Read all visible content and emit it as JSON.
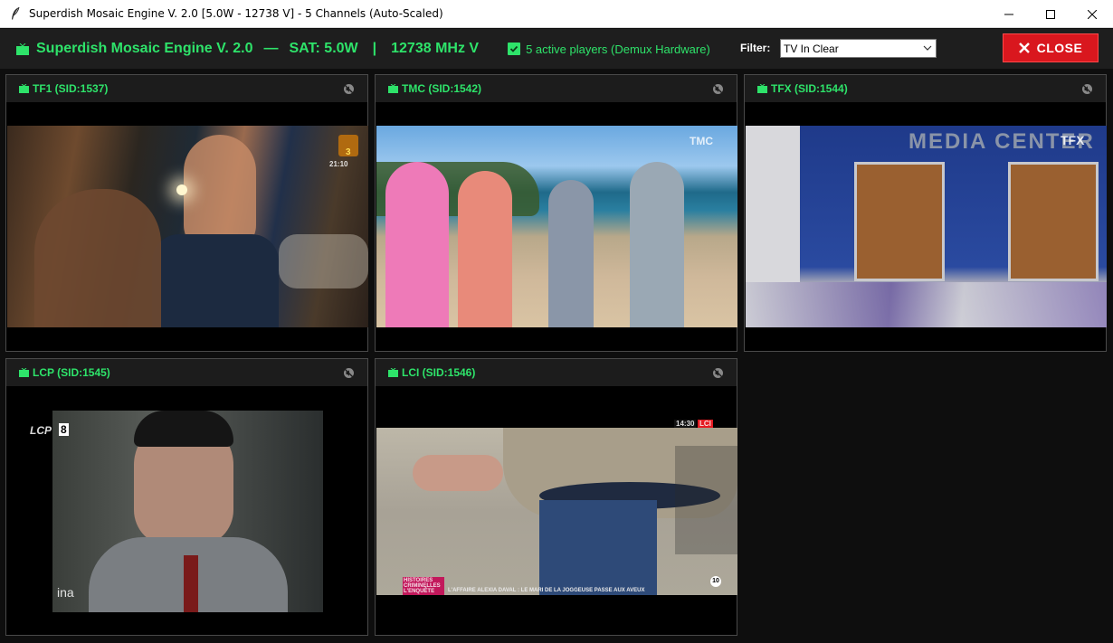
{
  "window": {
    "title": "Superdish Mosaic Engine V. 2.0 [5.0W - 12738 V] - 5 Channels (Auto-Scaled)"
  },
  "toolbar": {
    "app_name": "Superdish Mosaic Engine V. 2.0",
    "separator1": "—",
    "sat": "SAT: 5.0W",
    "separator2": "|",
    "freq": "12738 MHz V",
    "status": "5 active players (Demux Hardware)",
    "filter_label": "Filter:",
    "filter_value": "TV In Clear",
    "close_label": "CLOSE"
  },
  "colors": {
    "accent": "#2ee36a",
    "close": "#d9171e",
    "background": "#0e0e0e",
    "panel_header": "#1c1c1c"
  },
  "channels": [
    {
      "name": "TF1 (SID:1537)",
      "icon": "tv-icon",
      "audio": "muted-speaker-icon",
      "overlay": {
        "badge": "3",
        "time": "21:10"
      }
    },
    {
      "name": "TMC (SID:1542)",
      "icon": "tv-icon",
      "audio": "muted-speaker-icon",
      "overlay": {
        "logo": "TMC"
      }
    },
    {
      "name": "TFX (SID:1544)",
      "icon": "tv-icon",
      "audio": "muted-speaker-icon",
      "overlay": {
        "logo": "TFX",
        "sign": "MEDIA CENTER"
      }
    },
    {
      "name": "LCP (SID:1545)",
      "icon": "tv-icon",
      "audio": "muted-speaker-icon",
      "overlay": {
        "logo": "LCP",
        "badge": "8",
        "archive": "ina"
      }
    },
    {
      "name": "LCI (SID:1546)",
      "icon": "tv-icon",
      "audio": "muted-speaker-icon",
      "overlay": {
        "time": "14:30",
        "logo": "LCI",
        "show": "HISTOIRES CRIMINELLES L'ENQUÊTE",
        "ticker": "L'AFFAIRE ALEXIA DAVAL : LE MARI DE LA JOGGEUSE PASSE AUX AVEUX",
        "rating": "10"
      }
    }
  ]
}
